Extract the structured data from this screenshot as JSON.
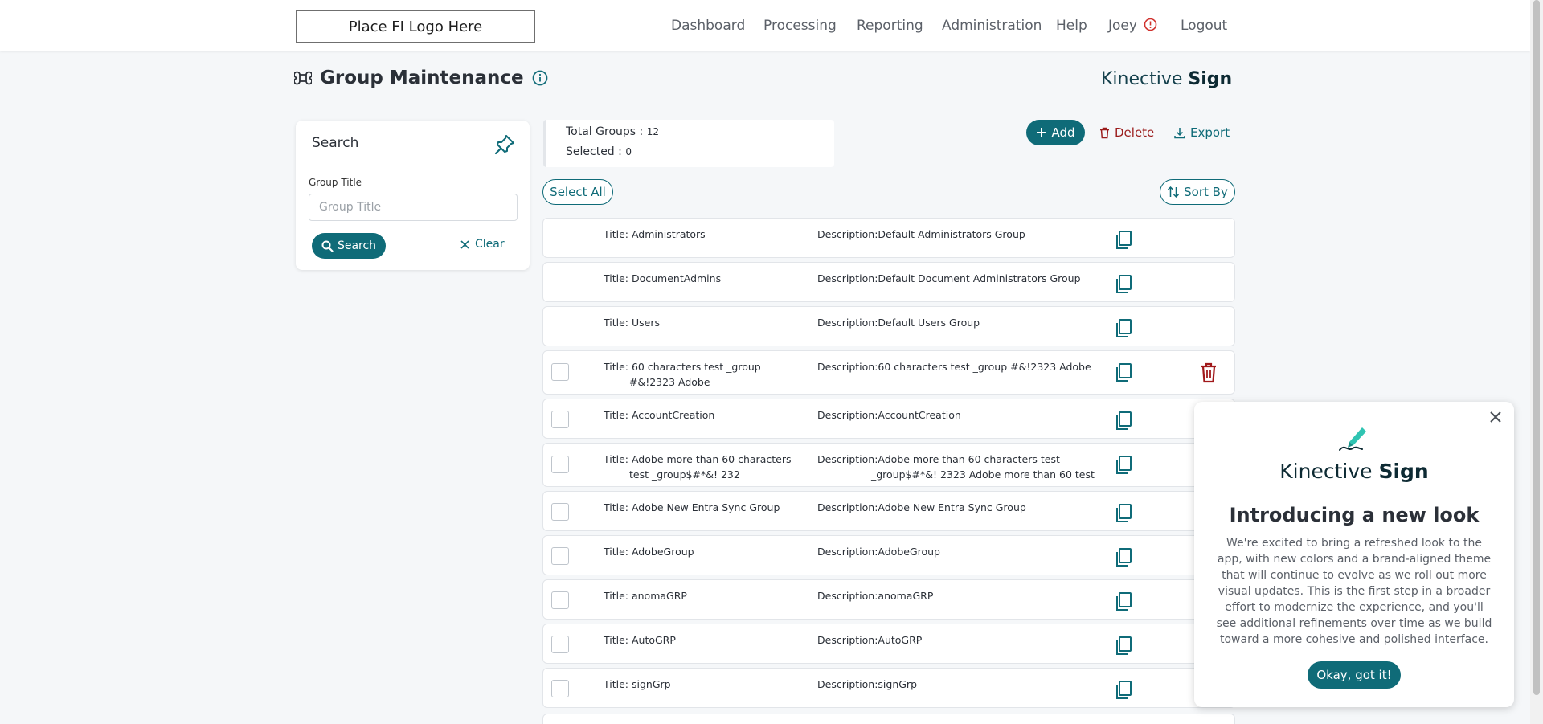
{
  "header": {
    "logo_text": "Place FI Logo Here",
    "nav": [
      "Dashboard",
      "Processing",
      "Reporting",
      "Administration",
      "Help",
      "Joey",
      "Logout"
    ]
  },
  "page": {
    "title": "Group Maintenance",
    "brand_light": "Kinective",
    "brand_bold": "Sign"
  },
  "search": {
    "title": "Search",
    "field_label": "Group Title",
    "field_placeholder": "Group Title",
    "field_value": "",
    "search_label": "Search",
    "clear_label": "Clear"
  },
  "summary": {
    "total_label": "Total Groups : ",
    "total_value": "12",
    "selected_label": "Selected : ",
    "selected_value": "0"
  },
  "toolbar": {
    "add_label": "Add",
    "delete_label": "Delete",
    "export_label": "Export",
    "select_all_label": "Select All",
    "sort_by_label": "Sort By"
  },
  "groups": [
    {
      "title": "Title: Administrators",
      "description": "Description:Default Administrators Group"
    },
    {
      "title": "Title: DocumentAdmins",
      "description": "Description:Default Document Administrators Group"
    },
    {
      "title": "Title: Users",
      "description": "Description:Default Users Group"
    },
    {
      "title": "Title: 60 characters test _group #&!2323 Adobe",
      "description": "Description:60 characters test _group #&!2323 Adobe"
    },
    {
      "title": "Title: AccountCreation",
      "description": "Description:AccountCreation"
    },
    {
      "title": "Title: Adobe more than 60 characters test _group$#*&! 232",
      "description": "Description:Adobe more than 60 characters test _group$#*&! 2323 Adobe more than 60 test"
    },
    {
      "title": "Title: Adobe New Entra Sync Group",
      "description": "Description:Adobe New Entra Sync Group"
    },
    {
      "title": "Title: AdobeGroup",
      "description": "Description:AdobeGroup"
    },
    {
      "title": "Title: anomaGRP",
      "description": "Description:anomaGRP"
    },
    {
      "title": "Title: AutoGRP",
      "description": "Description:AutoGRP"
    },
    {
      "title": "Title: signGrp",
      "description": "Description:signGrp"
    }
  ],
  "popup": {
    "brand_light": "Kinective",
    "brand_bold": "Sign",
    "heading": "Introducing a new look",
    "body": "We're excited to bring a refreshed look to the app, with new colors and a brand-aligned theme that will continue to evolve as we roll out more visual updates. This is the first step in a broader effort to modernize the experience, and you'll see additional refinements over time as we build toward a more cohesive and polished interface.",
    "button_label": "Okay, got it!"
  },
  "colors": {
    "accent": "#0f6b78",
    "danger": "#9b1c1c",
    "background": "#f5f7f9"
  },
  "icons": {
    "page": "command-icon",
    "info": "info-icon",
    "pin": "pin-icon",
    "alert": "alert-circle-icon",
    "copy": "copy-icon",
    "trash": "trash-icon",
    "close": "close-icon",
    "pen": "pen-icon"
  }
}
